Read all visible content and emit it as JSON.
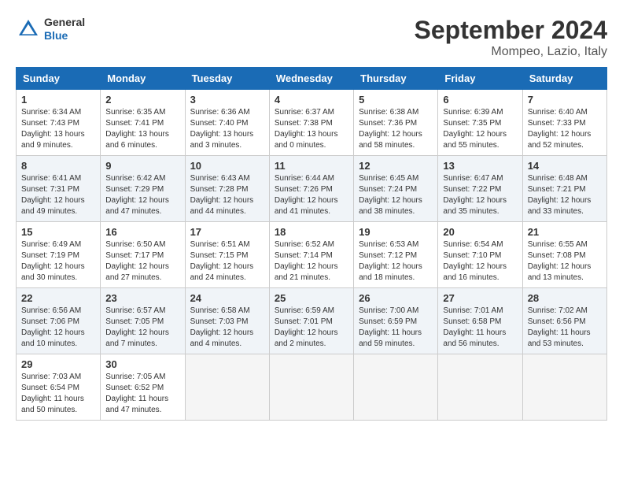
{
  "header": {
    "logo_general": "General",
    "logo_blue": "Blue",
    "month_title": "September 2024",
    "location": "Mompeo, Lazio, Italy"
  },
  "days_of_week": [
    "Sunday",
    "Monday",
    "Tuesday",
    "Wednesday",
    "Thursday",
    "Friday",
    "Saturday"
  ],
  "weeks": [
    [
      {
        "day": "1",
        "info": "Sunrise: 6:34 AM\nSunset: 7:43 PM\nDaylight: 13 hours and 9 minutes."
      },
      {
        "day": "2",
        "info": "Sunrise: 6:35 AM\nSunset: 7:41 PM\nDaylight: 13 hours and 6 minutes."
      },
      {
        "day": "3",
        "info": "Sunrise: 6:36 AM\nSunset: 7:40 PM\nDaylight: 13 hours and 3 minutes."
      },
      {
        "day": "4",
        "info": "Sunrise: 6:37 AM\nSunset: 7:38 PM\nDaylight: 13 hours and 0 minutes."
      },
      {
        "day": "5",
        "info": "Sunrise: 6:38 AM\nSunset: 7:36 PM\nDaylight: 12 hours and 58 minutes."
      },
      {
        "day": "6",
        "info": "Sunrise: 6:39 AM\nSunset: 7:35 PM\nDaylight: 12 hours and 55 minutes."
      },
      {
        "day": "7",
        "info": "Sunrise: 6:40 AM\nSunset: 7:33 PM\nDaylight: 12 hours and 52 minutes."
      }
    ],
    [
      {
        "day": "8",
        "info": "Sunrise: 6:41 AM\nSunset: 7:31 PM\nDaylight: 12 hours and 49 minutes."
      },
      {
        "day": "9",
        "info": "Sunrise: 6:42 AM\nSunset: 7:29 PM\nDaylight: 12 hours and 47 minutes."
      },
      {
        "day": "10",
        "info": "Sunrise: 6:43 AM\nSunset: 7:28 PM\nDaylight: 12 hours and 44 minutes."
      },
      {
        "day": "11",
        "info": "Sunrise: 6:44 AM\nSunset: 7:26 PM\nDaylight: 12 hours and 41 minutes."
      },
      {
        "day": "12",
        "info": "Sunrise: 6:45 AM\nSunset: 7:24 PM\nDaylight: 12 hours and 38 minutes."
      },
      {
        "day": "13",
        "info": "Sunrise: 6:47 AM\nSunset: 7:22 PM\nDaylight: 12 hours and 35 minutes."
      },
      {
        "day": "14",
        "info": "Sunrise: 6:48 AM\nSunset: 7:21 PM\nDaylight: 12 hours and 33 minutes."
      }
    ],
    [
      {
        "day": "15",
        "info": "Sunrise: 6:49 AM\nSunset: 7:19 PM\nDaylight: 12 hours and 30 minutes."
      },
      {
        "day": "16",
        "info": "Sunrise: 6:50 AM\nSunset: 7:17 PM\nDaylight: 12 hours and 27 minutes."
      },
      {
        "day": "17",
        "info": "Sunrise: 6:51 AM\nSunset: 7:15 PM\nDaylight: 12 hours and 24 minutes."
      },
      {
        "day": "18",
        "info": "Sunrise: 6:52 AM\nSunset: 7:14 PM\nDaylight: 12 hours and 21 minutes."
      },
      {
        "day": "19",
        "info": "Sunrise: 6:53 AM\nSunset: 7:12 PM\nDaylight: 12 hours and 18 minutes."
      },
      {
        "day": "20",
        "info": "Sunrise: 6:54 AM\nSunset: 7:10 PM\nDaylight: 12 hours and 16 minutes."
      },
      {
        "day": "21",
        "info": "Sunrise: 6:55 AM\nSunset: 7:08 PM\nDaylight: 12 hours and 13 minutes."
      }
    ],
    [
      {
        "day": "22",
        "info": "Sunrise: 6:56 AM\nSunset: 7:06 PM\nDaylight: 12 hours and 10 minutes."
      },
      {
        "day": "23",
        "info": "Sunrise: 6:57 AM\nSunset: 7:05 PM\nDaylight: 12 hours and 7 minutes."
      },
      {
        "day": "24",
        "info": "Sunrise: 6:58 AM\nSunset: 7:03 PM\nDaylight: 12 hours and 4 minutes."
      },
      {
        "day": "25",
        "info": "Sunrise: 6:59 AM\nSunset: 7:01 PM\nDaylight: 12 hours and 2 minutes."
      },
      {
        "day": "26",
        "info": "Sunrise: 7:00 AM\nSunset: 6:59 PM\nDaylight: 11 hours and 59 minutes."
      },
      {
        "day": "27",
        "info": "Sunrise: 7:01 AM\nSunset: 6:58 PM\nDaylight: 11 hours and 56 minutes."
      },
      {
        "day": "28",
        "info": "Sunrise: 7:02 AM\nSunset: 6:56 PM\nDaylight: 11 hours and 53 minutes."
      }
    ],
    [
      {
        "day": "29",
        "info": "Sunrise: 7:03 AM\nSunset: 6:54 PM\nDaylight: 11 hours and 50 minutes."
      },
      {
        "day": "30",
        "info": "Sunrise: 7:05 AM\nSunset: 6:52 PM\nDaylight: 11 hours and 47 minutes."
      },
      null,
      null,
      null,
      null,
      null
    ]
  ]
}
